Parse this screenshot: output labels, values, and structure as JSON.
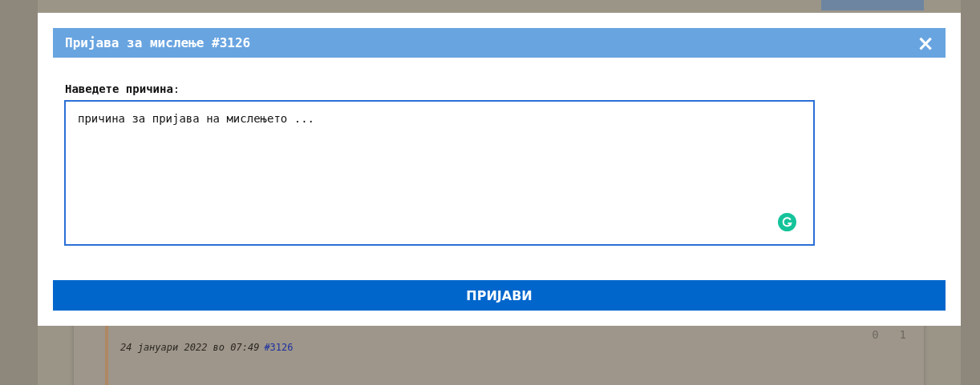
{
  "page": {
    "comment": {
      "date": "24 јануари 2022 во 07:49",
      "link": "#3126",
      "counts": [
        "0",
        "1"
      ]
    }
  },
  "dialog": {
    "title": "Пријава за мислење #3126",
    "close": "×",
    "label": "Наведете причина",
    "label_suffix": ":",
    "value": "причина за пријава на мислењето ...",
    "submit": "ПРИЈАВИ"
  }
}
